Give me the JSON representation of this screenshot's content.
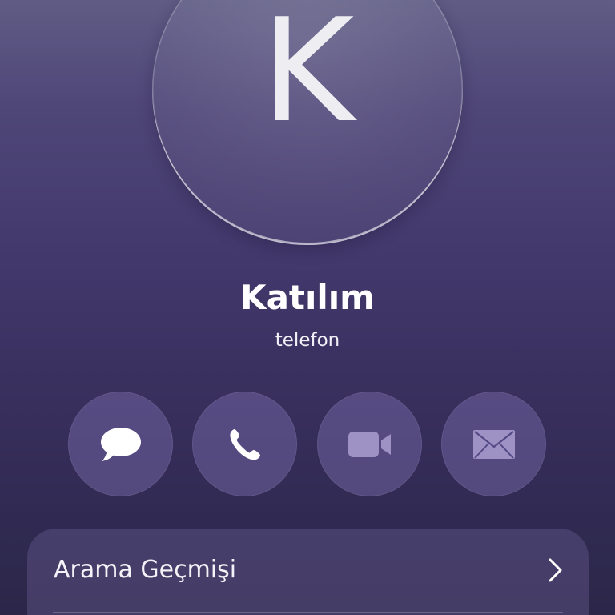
{
  "contact": {
    "initial": "K",
    "name": "Katılım",
    "subtitle": "telefon"
  },
  "actions": [
    {
      "id": "message",
      "icon": "message-bubble-icon",
      "enabled": true
    },
    {
      "id": "call",
      "icon": "phone-icon",
      "enabled": true
    },
    {
      "id": "video",
      "icon": "video-camera-icon",
      "enabled": false
    },
    {
      "id": "mail",
      "icon": "envelope-icon",
      "enabled": false
    }
  ],
  "card": {
    "rows": [
      {
        "label": "Arama Geçmişi",
        "icon": "chevron-right-icon"
      }
    ]
  },
  "colors": {
    "background_top": "#5f5c85",
    "background_bottom": "#2c2749",
    "icon_enabled": "#ffffff",
    "icon_disabled": "#9e92c4"
  }
}
